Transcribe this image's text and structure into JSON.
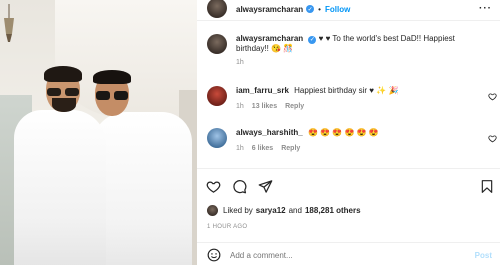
{
  "post": {
    "author": "alwaysramcharan",
    "follow_label": "Follow",
    "dot": "•",
    "caption_user": "alwaysramcharan",
    "caption_text": "♥ ♥ To the world's best DaD!! Happiest birthday!! 😘 🎊",
    "caption_time": "1h"
  },
  "comments": [
    {
      "user": "iam_farru_srk",
      "text": "Happiest birthday sir ♥ ✨ 🎉",
      "time": "1h",
      "likes": "13 likes",
      "reply": "Reply"
    },
    {
      "user": "always_harshith_",
      "text": "😍 😍 😍 😍 😍 😍",
      "time": "1h",
      "likes": "6 likes",
      "reply": "Reply"
    }
  ],
  "likes": {
    "prefix": "Liked by",
    "user": "sarya12",
    "connector": "and",
    "others": "188,281 others"
  },
  "timestamp": "1 HOUR AGO",
  "composer": {
    "placeholder": "Add a comment...",
    "post_label": "Post"
  },
  "icons": {
    "heart": "heart-icon",
    "comment": "comment-icon",
    "share": "share-icon",
    "bookmark": "bookmark-icon",
    "more": "more-icon",
    "emoji": "emoji-icon"
  }
}
